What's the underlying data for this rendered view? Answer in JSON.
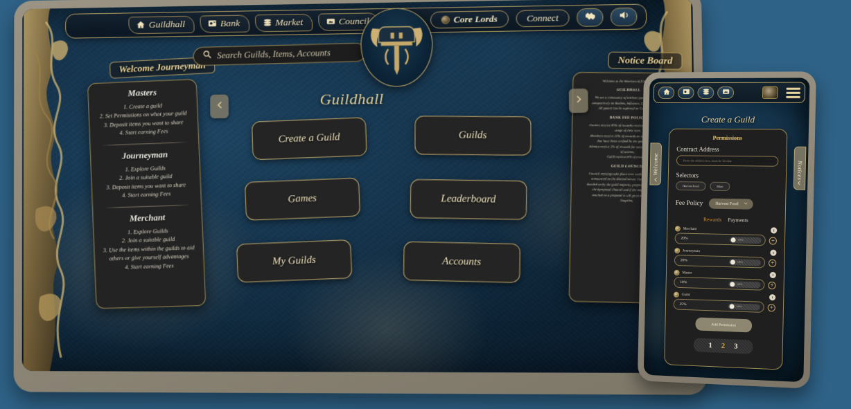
{
  "topbar": {
    "nav_items": [
      {
        "label": "Guildhall",
        "icon": "home-icon"
      },
      {
        "label": "Bank",
        "icon": "vault-icon"
      },
      {
        "label": "Market",
        "icon": "coins-icon"
      },
      {
        "label": "Council",
        "icon": "scroll-icon"
      }
    ],
    "core_lords_label": "Core Lords",
    "connect_label": "Connect",
    "handshake_icon": "handshake-icon",
    "sound_icon": "speaker-icon"
  },
  "search": {
    "placeholder": "Search Guilds, Items, Accounts",
    "value": "",
    "icon": "search-icon"
  },
  "page": {
    "title": "Guildhall",
    "emblem": "viking-helmet-emblem"
  },
  "menu": {
    "buttons": [
      "Create a Guild",
      "Guilds",
      "Games",
      "Leaderboard",
      "My Guilds",
      "Accounts"
    ]
  },
  "welcome": {
    "header": "Welcome Journeyman",
    "roles": [
      {
        "title": "Masters",
        "steps": [
          "1.  Create a guild",
          "2.  Set Permissions on what your guild",
          "3.  Deposit items you want to share",
          "4.  Start earning Fees"
        ]
      },
      {
        "title": "Journeyman",
        "steps": [
          "1.  Explore Guilds",
          "2.  Join a suitable guild",
          "3.  Deposit items you want to share",
          "4.  Start earning Fees"
        ]
      },
      {
        "title": "Merchant",
        "steps": [
          "1.  Explore Guilds",
          "2.  Join a suitable guild",
          "3.  Use the items within the guilds to aid others or give yourself advantages",
          "4.  Start earning Fees"
        ]
      }
    ]
  },
  "notice": {
    "header": "Notice Board",
    "intro": "Welcome to the Warriors of Fire Guild",
    "sections": [
      {
        "heading": "GUILDHALL",
        "lines": [
          "We are a community of starknet gamers who play",
          "competitively on Realms, Influence, Eykar and NoGa.",
          "All games can be explored on Cartridge.gg."
        ]
      },
      {
        "heading": "BANK FEE POLICY",
        "lines": [
          "Owners receive 80% of rewards received by the guild for",
          "usage of their item.",
          "Members receive 10% of rewards on successful actions",
          "that have been verified by the game contract.",
          "Admins receive 2% of rewards for successful verification",
          "of actions.",
          "Guild receives 8% of rewards."
        ]
      },
      {
        "heading": "GUILD COUNCIL",
        "lines": [
          "Council meetings take place ever week, meetings will be",
          "announced on the discord server. Guild votes will be",
          "decided on by the guild majority, proposals can be made in",
          "the #proposal channel and if the majority has been",
          "reached on a proposal it will go to a vote hosted on",
          "Snapshot."
        ]
      }
    ]
  },
  "arrows": {
    "left": "chevron-left-icon",
    "right": "chevron-right-icon"
  },
  "mobile": {
    "nav_icons": [
      "home-icon",
      "vault-icon",
      "coins-icon",
      "scroll-icon"
    ],
    "avatar": "avatar",
    "menu_icon": "hamburger-menu-icon",
    "title": "Create a Guild",
    "section_title": "Permissions",
    "contract_address_label": "Contract Address",
    "contract_address_placeholder": "Paste the address box, must be 32 char",
    "contract_address_value": "",
    "selectors_label": "Selectors",
    "selector_chips": [
      "Harvest Food",
      "Mine"
    ],
    "fee_policy_label": "Fee Policy",
    "fee_policy_value": "Harvest Food",
    "tabs": [
      {
        "label": "Rewards",
        "active": true
      },
      {
        "label": "Payments",
        "active": false
      }
    ],
    "permissions": [
      {
        "name": "Merchant",
        "percent": "20%",
        "badge": "1",
        "slider_label": "100%",
        "icon": "merchant-icon"
      },
      {
        "name": "Journeyman",
        "percent": "20%",
        "badge": "1",
        "slider_label": "100%",
        "icon": "journeyman-icon"
      },
      {
        "name": "Master",
        "percent": "10%",
        "badge": "1",
        "slider_label": "100%",
        "icon": "master-icon"
      },
      {
        "name": "Guild",
        "percent": "25%",
        "badge": "1",
        "slider_label": "100%",
        "icon": "guild-icon"
      }
    ],
    "add_permission_label": "Add Permission",
    "pager": [
      {
        "label": "1",
        "current": false
      },
      {
        "label": "2",
        "current": true
      },
      {
        "label": "3",
        "current": false
      }
    ],
    "side_tab_welcome": "Welcome",
    "side_tab_notices": "Notices"
  },
  "colors": {
    "gold": "#c8ad6c",
    "gold_text": "#ecd79f",
    "panel": "#232323",
    "accent_orange": "#c9913c",
    "page_bg": "#2e6287"
  }
}
